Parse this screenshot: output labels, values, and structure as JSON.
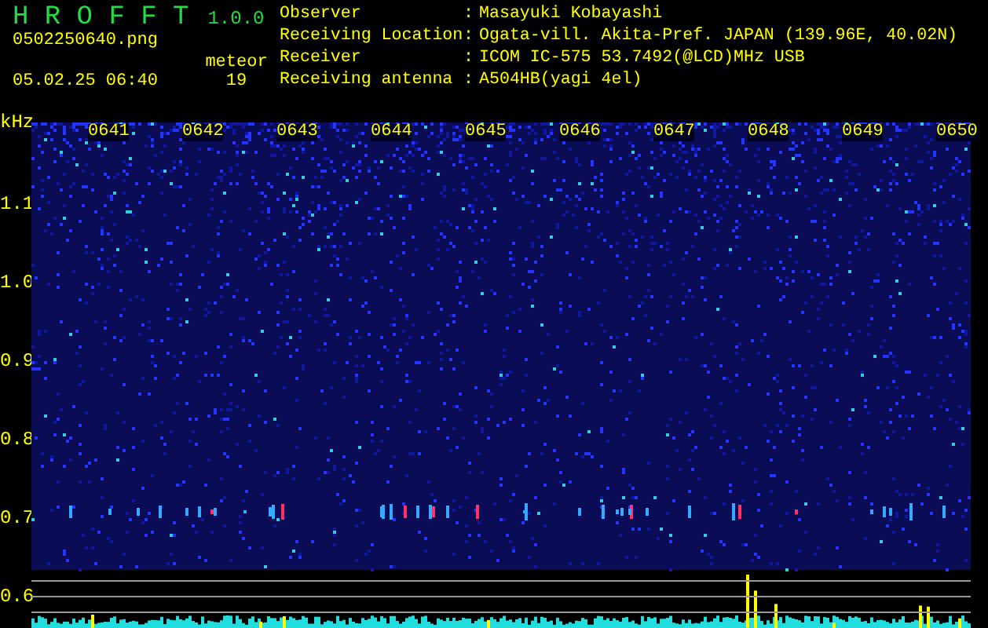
{
  "app": {
    "title": "H R O F F T",
    "version": "1.0.0"
  },
  "file": {
    "name": "0502250640.png",
    "datetime": "05.02.25 06:40"
  },
  "meteor": {
    "label": "meteor",
    "count": "19"
  },
  "info": [
    {
      "label": "Observer",
      "separator": ":",
      "value": "Masayuki Kobayashi"
    },
    {
      "label": "Receiving Location",
      "separator": ":",
      "value": "Ogata-vill. Akita-Pref. JAPAN (139.96E, 40.02N)"
    },
    {
      "label": "Receiver",
      "separator": ":",
      "value": "ICOM IC-575 53.7492(@LCD)MHz USB"
    },
    {
      "label": "Receiving antenna",
      "separator": ":",
      "value": "A504HB(yagi 4el)"
    }
  ],
  "axis": {
    "unit": "kHz",
    "frequencies": [
      "1.1",
      "1.0",
      "0.9",
      "0.8",
      "0.7",
      "0.6"
    ],
    "times": [
      "0641",
      "0642",
      "0643",
      "0644",
      "0645",
      "0646",
      "0647",
      "0648",
      "0649",
      "0650"
    ]
  }
}
